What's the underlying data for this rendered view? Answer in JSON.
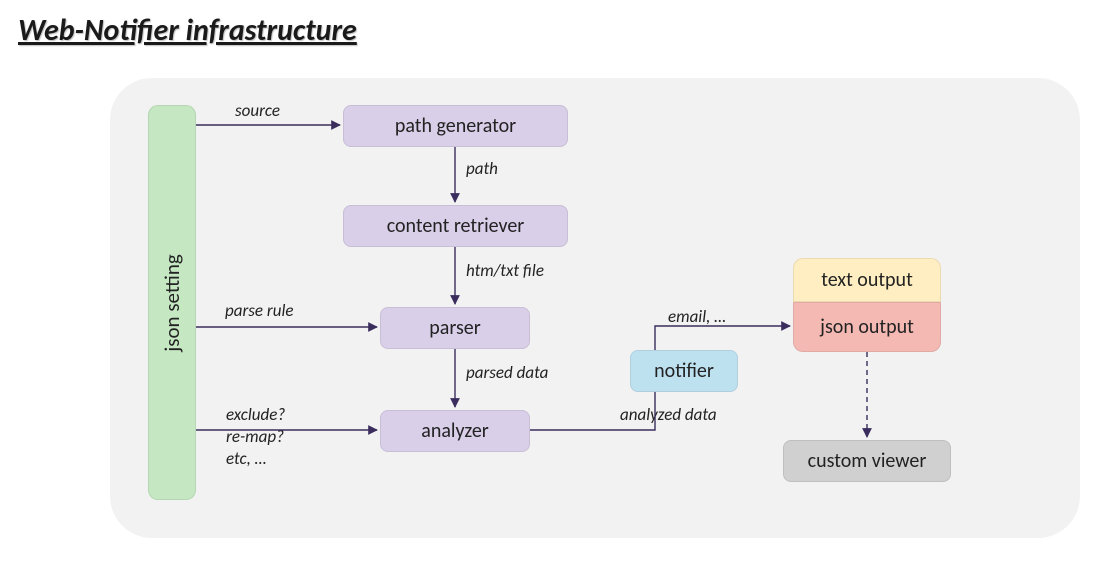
{
  "title": "Web-Notifier infrastructure",
  "nodes": {
    "json_setting": "json setting",
    "path_generator": "path generator",
    "content_retriever": "content retriever",
    "parser": "parser",
    "analyzer": "analyzer",
    "notifier": "notifier",
    "text_output": "text output",
    "json_output": "json output",
    "custom_viewer": "custom viewer"
  },
  "edges": {
    "source": "source",
    "parse_rule": "parse rule",
    "exclude": "exclude?",
    "remap": "re-map?",
    "etc": "etc, …",
    "path": "path",
    "htm_txt": "htm/txt file",
    "parsed_data": "parsed data",
    "analyzed_data": "analyzed data",
    "email": "email, …"
  },
  "colors": {
    "purple": "#d9cfe9",
    "green": "#c5e8c3",
    "blue": "#bee1f0",
    "yellow": "#ffeec1",
    "pink": "#f5b9b3",
    "gray": "#d0d0d0",
    "arrow": "#3a2d5d"
  }
}
